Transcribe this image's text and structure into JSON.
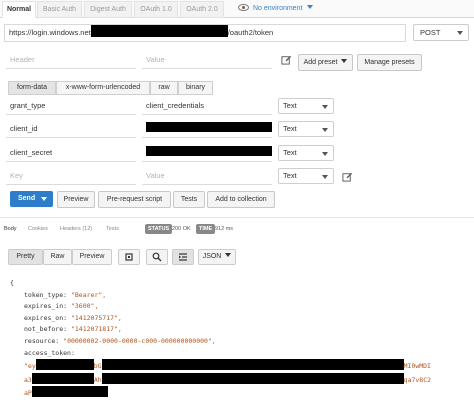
{
  "auth_tabs": [
    {
      "label": "Normal"
    },
    {
      "label": "Basic Auth"
    },
    {
      "label": "Digest Auth"
    },
    {
      "label": "OAuth 1.0"
    },
    {
      "label": "OAuth 2.0"
    }
  ],
  "environment": {
    "label": "No environment"
  },
  "request": {
    "url_prefix": "https://login.windows.net",
    "url_suffix": "/oauth2/token",
    "method": "POST"
  },
  "headers_row": {
    "header_placeholder": "Header",
    "value_placeholder": "Value",
    "add_preset": "Add preset",
    "manage_presets": "Manage presets"
  },
  "body_types": [
    {
      "label": "form-data"
    },
    {
      "label": "x-www-form-urlencoded"
    },
    {
      "label": "raw"
    },
    {
      "label": "binary"
    }
  ],
  "form_rows": [
    {
      "key": "grant_type",
      "value": "client_credentials",
      "type": "Text"
    },
    {
      "key": "client_id",
      "value": "",
      "type": "Text"
    },
    {
      "key": "client_secret",
      "value": "",
      "type": "Text"
    }
  ],
  "new_row": {
    "key_placeholder": "Key",
    "value_placeholder": "Value",
    "type": "Text"
  },
  "actions": {
    "send": "Send",
    "preview": "Preview",
    "prerequest": "Pre-request script",
    "tests": "Tests",
    "add_collection": "Add to collection"
  },
  "response_tabs": [
    {
      "label": "Body"
    },
    {
      "label": "Cookies"
    },
    {
      "label": "Headers (12)"
    },
    {
      "label": "Tests"
    }
  ],
  "status": {
    "label": "STATUS",
    "value": "200 OK"
  },
  "time": {
    "label": "TIME",
    "value": "912 ms"
  },
  "view_buttons": {
    "pretty": "Pretty",
    "raw": "Raw",
    "preview": "Preview",
    "format": "JSON"
  },
  "json_body": {
    "open": "{",
    "close": "}",
    "lines": [
      {
        "key": "token_type:",
        "value": "\"Bearer\","
      },
      {
        "key": "expires_in:",
        "value": "\"3600\","
      },
      {
        "key": "expires_on:",
        "value": "\"1412075717\","
      },
      {
        "key": "not_before:",
        "value": "\"1412071817\","
      },
      {
        "key": "resource:",
        "value": "\"00000002-0000-0000-c000-000000000000\","
      },
      {
        "key": "access_token:",
        "value": ""
      }
    ],
    "token_lines": [
      {
        "left": "\"ey",
        "mid": "bG",
        "right": "MI0wMDI"
      },
      {
        "left": "a3",
        "mid": "Ah",
        "right": "qa7v8C2"
      },
      {
        "left": "aP",
        "mid": "",
        "right": ""
      }
    ]
  },
  "colors": {
    "accent": "#2e7ccc",
    "badge": "#888888",
    "string": "#b0541d"
  }
}
